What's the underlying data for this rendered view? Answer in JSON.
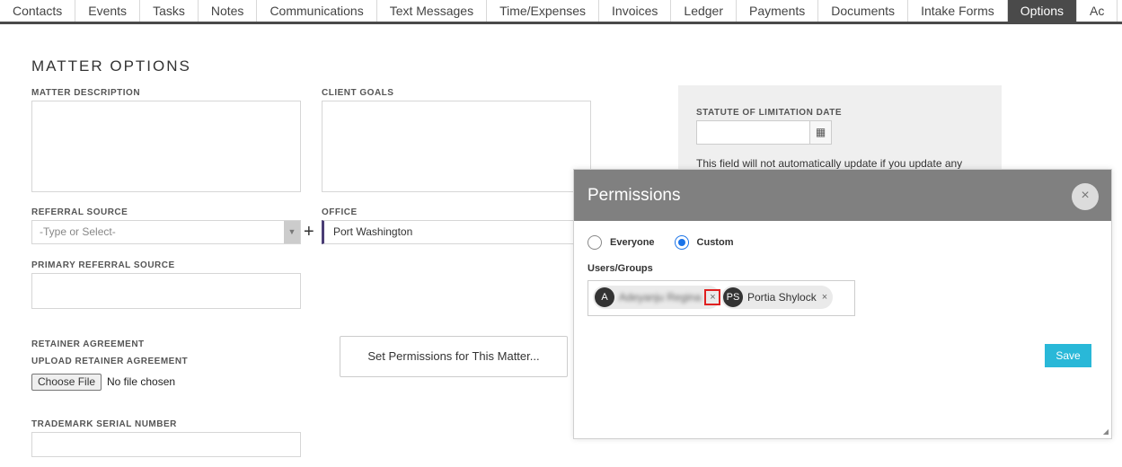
{
  "tabs": [
    {
      "label": "Contacts",
      "active": false
    },
    {
      "label": "Events",
      "active": false
    },
    {
      "label": "Tasks",
      "active": false
    },
    {
      "label": "Notes",
      "active": false
    },
    {
      "label": "Communications",
      "active": false
    },
    {
      "label": "Text Messages",
      "active": false
    },
    {
      "label": "Time/Expenses",
      "active": false
    },
    {
      "label": "Invoices",
      "active": false
    },
    {
      "label": "Ledger",
      "active": false
    },
    {
      "label": "Payments",
      "active": false
    },
    {
      "label": "Documents",
      "active": false
    },
    {
      "label": "Intake Forms",
      "active": false
    },
    {
      "label": "Options",
      "active": true
    },
    {
      "label": "Ac",
      "active": false
    }
  ],
  "form": {
    "title": "MATTER OPTIONS",
    "matter_description_label": "MATTER DESCRIPTION",
    "client_goals_label": "CLIENT GOALS",
    "referral_source_label": "REFERRAL SOURCE",
    "referral_source_placeholder": "-Type or Select-",
    "add_symbol": "+",
    "office_label": "OFFICE",
    "office_value": "Port Washington",
    "primary_referral_label": "PRIMARY REFERRAL SOURCE",
    "retainer_label": "RETAINER AGREEMENT",
    "upload_label": "UPLOAD RETAINER AGREEMENT",
    "choose_file": "Choose File",
    "no_file": "No file chosen",
    "trademark_label": "TRADEMARK SERIAL NUMBER",
    "set_permissions": "Set Permissions for This Matter..."
  },
  "statute": {
    "label": "STATUTE OF LIMITATION DATE",
    "note": "This field will not automatically update if you update any"
  },
  "modal": {
    "title": "Permissions",
    "close": "×",
    "options": [
      {
        "label": "Everyone",
        "checked": false
      },
      {
        "label": "Custom",
        "checked": true
      }
    ],
    "users_label": "Users/Groups",
    "users": [
      {
        "initials": "A",
        "name": "Adeyanju Regina"
      },
      {
        "initials": "PS",
        "name": "Portia Shylock"
      }
    ],
    "remove": "×",
    "save": "Save"
  },
  "colors": {
    "accent": "#29b8d8",
    "tab_active": "#4a4a4a",
    "radio": "#1a73e8",
    "highlight": "#e02020"
  }
}
